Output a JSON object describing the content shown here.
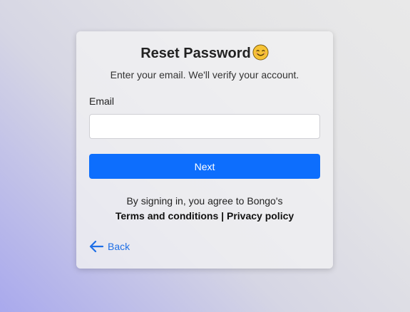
{
  "card": {
    "title": "Reset Password",
    "title_icon": "smiling-face-emoji-icon",
    "subtitle": "Enter your email. We'll verify your account."
  },
  "form": {
    "email_label": "Email",
    "email_value": "",
    "email_placeholder": "",
    "next_label": "Next"
  },
  "legal": {
    "agree_text": "By signing in, you agree to Bongo's",
    "terms_label": "Terms and conditions",
    "separator": " | ",
    "privacy_label": "Privacy policy"
  },
  "nav": {
    "back_label": "Back",
    "back_icon": "arrow-left-icon"
  },
  "colors": {
    "primary": "#0d6efd",
    "link": "#1f6fe6",
    "emoji": "#f6c335"
  }
}
